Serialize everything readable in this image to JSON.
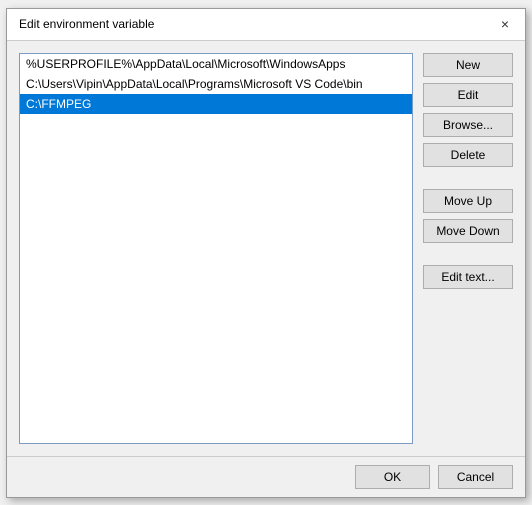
{
  "dialog": {
    "title": "Edit environment variable",
    "close_icon": "×"
  },
  "list": {
    "items": [
      {
        "id": 0,
        "text": "%USERPROFILE%\\AppData\\Local\\Microsoft\\WindowsApps",
        "selected": false
      },
      {
        "id": 1,
        "text": "C:\\Users\\Vipin\\AppData\\Local\\Programs\\Microsoft VS Code\\bin",
        "selected": false
      },
      {
        "id": 2,
        "text": "C:\\FFMPEG",
        "selected": true
      }
    ]
  },
  "buttons": {
    "new": "New",
    "edit": "Edit",
    "browse": "Browse...",
    "delete": "Delete",
    "move_up": "Move Up",
    "move_down": "Move Down",
    "edit_text": "Edit text..."
  },
  "footer": {
    "ok": "OK",
    "cancel": "Cancel"
  }
}
